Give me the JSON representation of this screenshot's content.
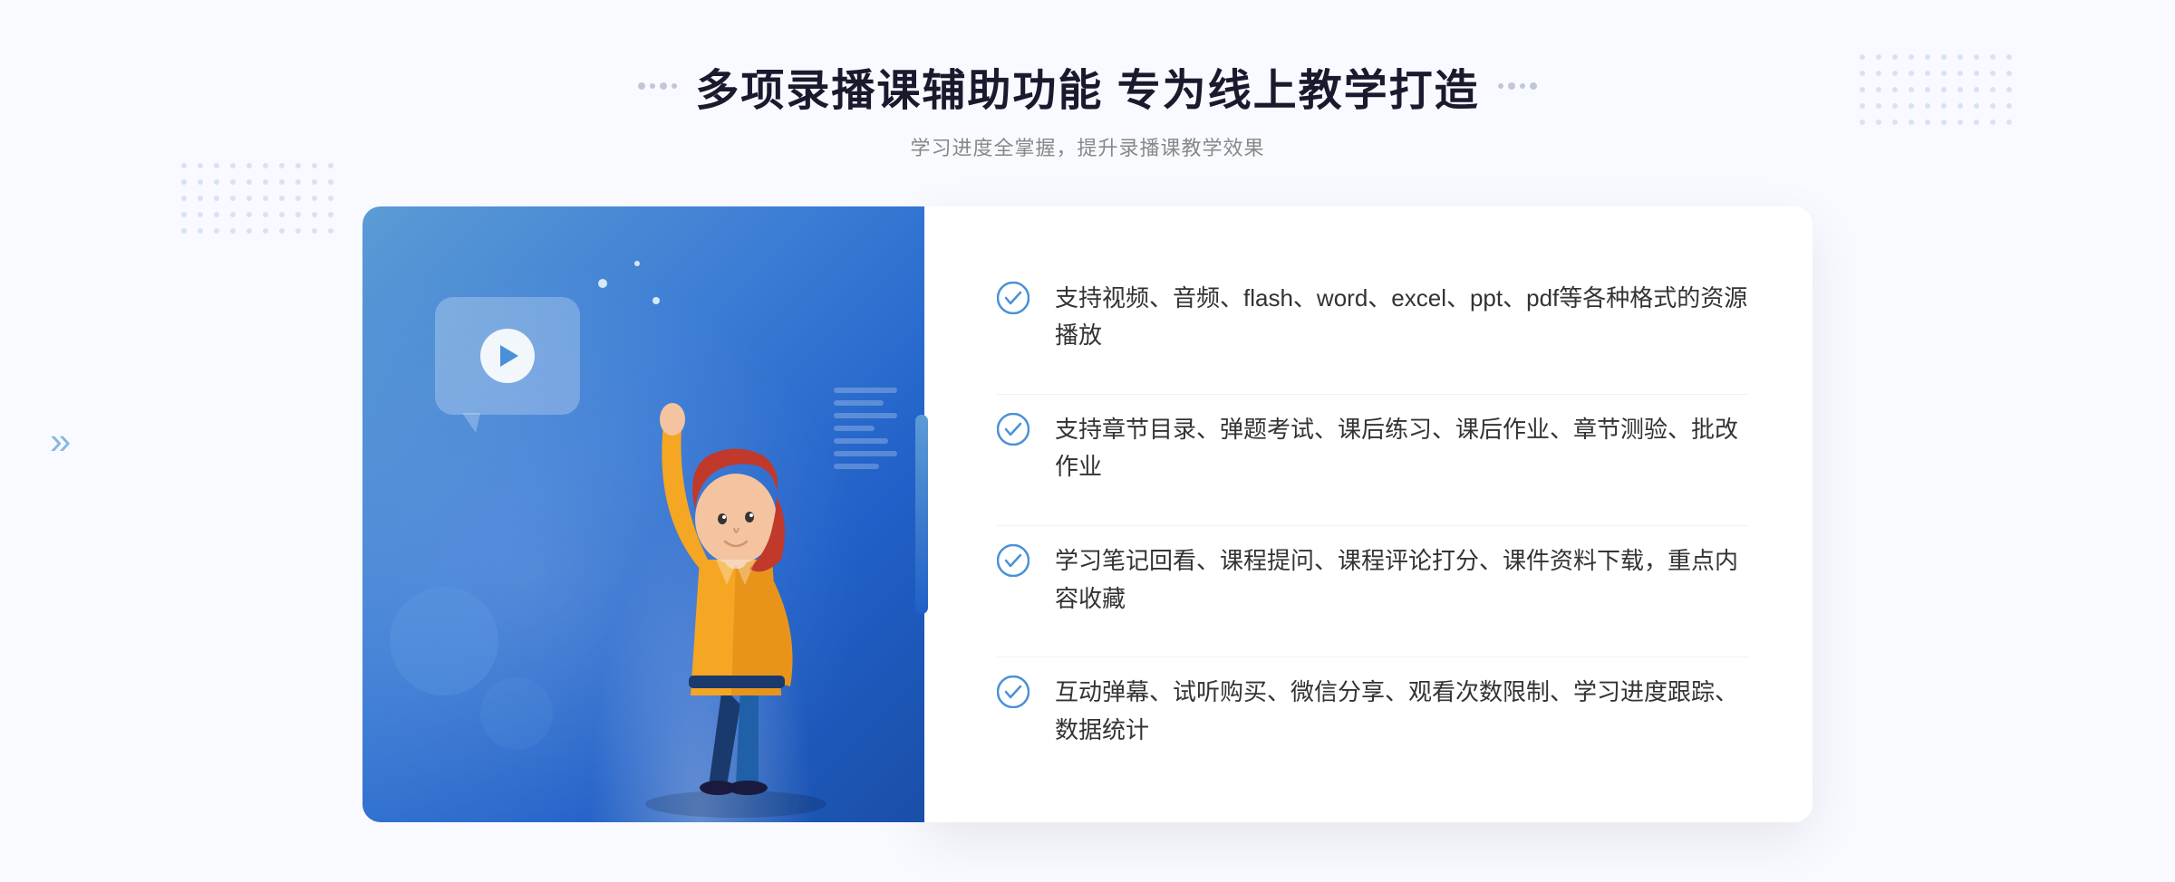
{
  "page": {
    "background_color": "#f8faff"
  },
  "header": {
    "main_title": "多项录播课辅助功能 专为线上教学打造",
    "sub_title": "学习进度全掌握，提升录播课教学效果"
  },
  "features": [
    {
      "id": "feature-1",
      "text": "支持视频、音频、flash、word、excel、ppt、pdf等各种格式的资源播放"
    },
    {
      "id": "feature-2",
      "text": "支持章节目录、弹题考试、课后练习、课后作业、章节测验、批改作业"
    },
    {
      "id": "feature-3",
      "text": "学习笔记回看、课程提问、课程评论打分、课件资料下载，重点内容收藏"
    },
    {
      "id": "feature-4",
      "text": "互动弹幕、试听购买、微信分享、观看次数限制、学习进度跟踪、数据统计"
    }
  ],
  "icons": {
    "check": "check-circle",
    "play": "play-triangle",
    "arrow_left": "«"
  },
  "colors": {
    "primary_blue": "#2060c8",
    "light_blue": "#5b9bd5",
    "text_dark": "#1a1a2e",
    "text_gray": "#888888",
    "feature_text": "#333333",
    "white": "#ffffff",
    "check_color": "#4a90d9"
  }
}
